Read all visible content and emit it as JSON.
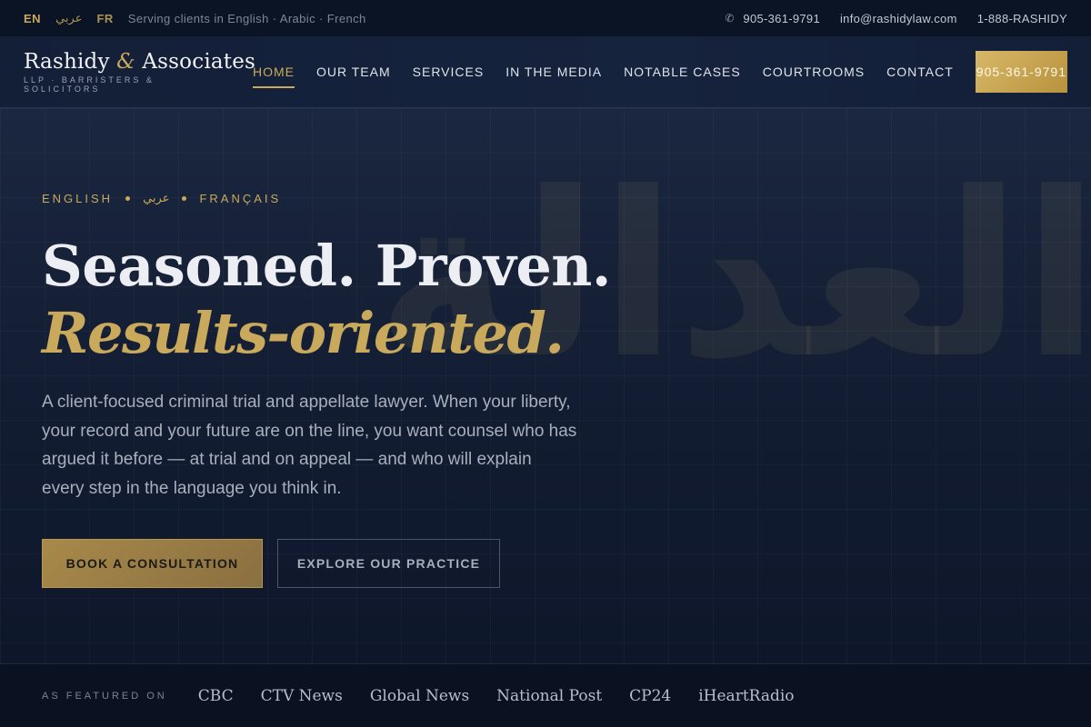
{
  "topbar": {
    "languages": [
      {
        "code": "EN",
        "active": true
      },
      {
        "code": "عربي",
        "active": false
      },
      {
        "code": "FR",
        "active": false
      }
    ],
    "serving_text": "Serving clients in English · Arabic · French",
    "phone": "905-361-9791",
    "email": "info@rashidylaw.com",
    "tollfree": "1-888-RASHIDY",
    "phone_icon": "phone-icon"
  },
  "header": {
    "brand_part1": "Rashidy ",
    "brand_amp": "&",
    "brand_part2": " Associates",
    "brand_sub": "LLP · BARRISTERS & SOLICITORS",
    "nav": [
      {
        "label": "HOME",
        "active": true
      },
      {
        "label": "OUR TEAM",
        "active": false
      },
      {
        "label": "SERVICES",
        "active": false
      },
      {
        "label": "IN THE MEDIA",
        "active": false
      },
      {
        "label": "NOTABLE CASES",
        "active": false
      },
      {
        "label": "COURTROOMS",
        "active": false
      },
      {
        "label": "CONTACT",
        "active": false
      }
    ],
    "cta": "905-361-9791"
  },
  "hero": {
    "languages": [
      "ENGLISH",
      "عربي",
      "FRANÇAIS"
    ],
    "title": "Seasoned. Proven.",
    "title_accent": "Results-oriented.",
    "watermark": "العدالة",
    "description": "A client-focused criminal trial and appellate lawyer. When your liberty, your record and your future are on the line, you want counsel who has argued it before — at trial and on appeal — and who will explain every step in the language you think in.",
    "primary_button": "BOOK A CONSULTATION",
    "secondary_button": "EXPLORE OUR PRACTICE"
  },
  "featured": {
    "label": "AS FEATURED ON",
    "outlets": [
      "CBC",
      "CTV News",
      "Global News",
      "National Post",
      "CP24",
      "iHeartRadio"
    ]
  },
  "colors": {
    "accent_gold": "#c9a95c",
    "background_navy": "#0f1a2e"
  }
}
